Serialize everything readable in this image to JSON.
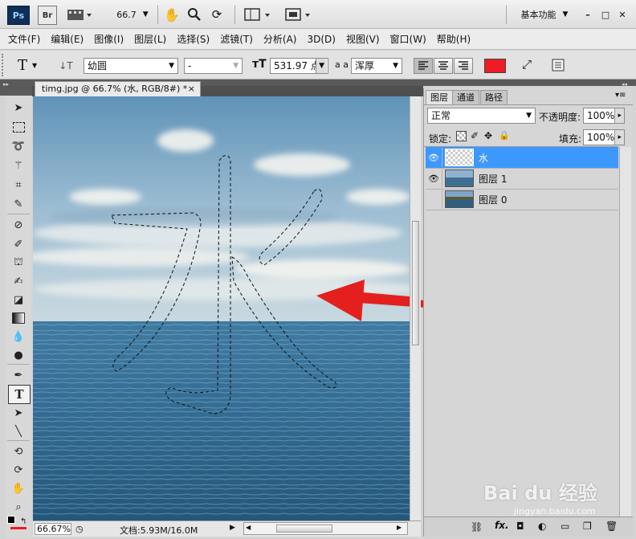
{
  "titlebar": {
    "ps_logo": "Ps",
    "br_logo": "Br",
    "zoom": "66.7",
    "workspace": "基本功能",
    "minimize": "–",
    "restore": "□",
    "close": "✕"
  },
  "menu": [
    "文件(F)",
    "编辑(E)",
    "图像(I)",
    "图层(L)",
    "选择(S)",
    "滤镜(T)",
    "分析(A)",
    "3D(D)",
    "视图(V)",
    "窗口(W)",
    "帮助(H)"
  ],
  "options": {
    "tool_glyph": "T",
    "font_family": "幼圆",
    "font_style": "-",
    "font_size": "531.97 点",
    "aa_label": "a a",
    "antialias": "浑厚",
    "color": "#ee1c24"
  },
  "document": {
    "tab_title": "timg.jpg @ 66.7% (水, RGB/8#) *",
    "tab_close": "×"
  },
  "status": {
    "zoom": "66.67%",
    "doc_info": "文档:5.93M/16.0M"
  },
  "layers_panel": {
    "tabs": [
      "图层",
      "通道",
      "路径"
    ],
    "blend_mode": "正常",
    "opacity_label": "不透明度:",
    "opacity_value": "100%",
    "lock_label": "锁定:",
    "fill_label": "填充:",
    "fill_value": "100%",
    "layers": [
      {
        "name": "水",
        "visible": true,
        "selected": true
      },
      {
        "name": "图层 1",
        "visible": true,
        "selected": false
      },
      {
        "name": "图层 0",
        "visible": false,
        "selected": false
      }
    ]
  },
  "colors": {
    "selection": "#3d98fe",
    "arrow": "#e3201e",
    "sky_top": "#6f9ebf",
    "sea": "#2d5f83"
  },
  "watermark": {
    "brand": "Bai du 经验",
    "url": "jingyan.baidu.com"
  }
}
